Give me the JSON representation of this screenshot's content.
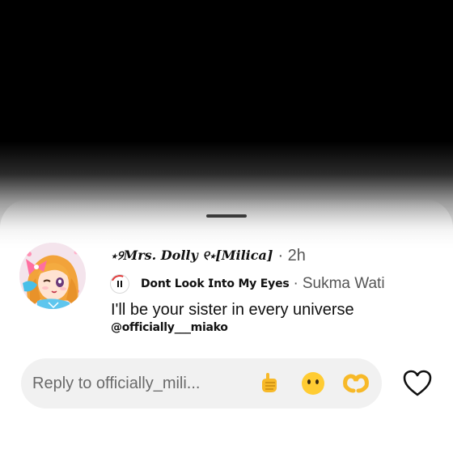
{
  "comment": {
    "username": "⋆୨𝑴𝒓𝒔. 𝑫𝒐𝒍𝒍𝒚 ୧⋆[𝑴𝒊𝒍𝒊𝒄𝒂]",
    "time": "· 2h",
    "music": {
      "title": "𝗗𝗼𝗻𝘁 𝗟𝗼𝗼𝗸 𝗜𝗻𝘁𝗼 𝗠𝘆 𝗘𝘆𝗲𝘀",
      "separator": "·",
      "artist": "Sukma Wati"
    },
    "caption": "I'll be your sister in every universe",
    "mention": "@officially___miako"
  },
  "reply": {
    "placeholder": "Reply to officially_mili...",
    "emoji_1": "fist-bump-emoji",
    "emoji_2": "face-without-mouth-emoji",
    "emoji_3": "heart-hands-emoji",
    "like_icon": "heart-outline-icon"
  },
  "colors": {
    "sheet_top": "#000000",
    "text_primary": "#111111",
    "text_secondary": "#555555",
    "reply_bg": "#f1f1f1",
    "progress_ring": "#e23b3b"
  }
}
